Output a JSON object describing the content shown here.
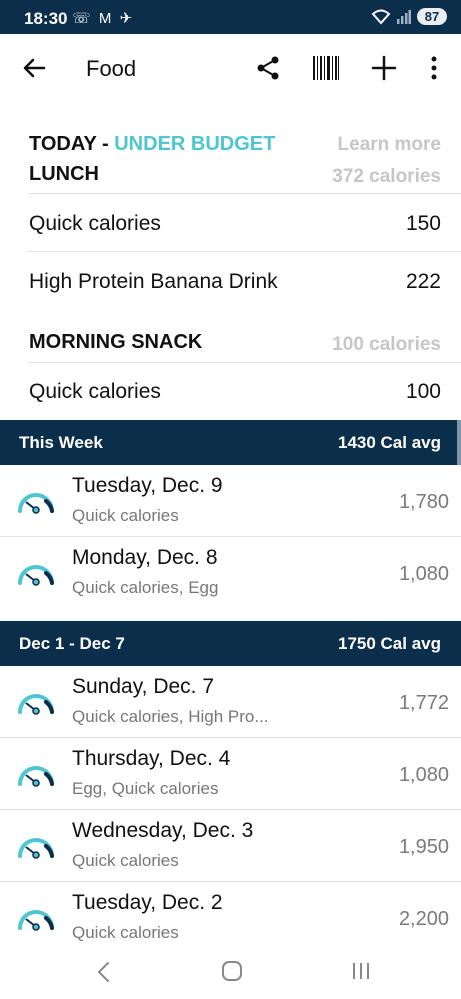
{
  "status": {
    "time": "18:30",
    "icons": "☏ M ✈",
    "battery": "87"
  },
  "appbar": {
    "title": "Food"
  },
  "today": {
    "label": "TODAY",
    "dash": " - ",
    "budget_status": "UNDER BUDGET",
    "learn_more": "Learn more",
    "colors": {
      "accent": "#4ec6d2",
      "navy": "#0b2e4a"
    }
  },
  "lunch": {
    "label": "LUNCH",
    "calories": "372 calories",
    "items": [
      {
        "name": "Quick calories",
        "value": "150"
      },
      {
        "name": "High Protein Banana Drink",
        "value": "222"
      }
    ]
  },
  "morning_snack": {
    "label": "MORNING SNACK",
    "calories": "100 calories",
    "items": [
      {
        "name": "Quick calories",
        "value": "100"
      }
    ]
  },
  "weeks": [
    {
      "label": "This Week",
      "avg": "1430 Cal avg",
      "days": [
        {
          "day": "Tuesday, Dec. 9",
          "foods": "Quick calories",
          "calories": "1,780"
        },
        {
          "day": "Monday, Dec. 8",
          "foods": "Quick calories, Egg",
          "calories": "1,080"
        }
      ]
    },
    {
      "label": "Dec 1 - Dec 7",
      "avg": "1750 Cal avg",
      "days": [
        {
          "day": "Sunday, Dec. 7",
          "foods": "Quick calories, High Pro...",
          "calories": "1,772"
        },
        {
          "day": "Thursday, Dec. 4",
          "foods": "Egg, Quick calories",
          "calories": "1,080"
        },
        {
          "day": "Wednesday, Dec. 3",
          "foods": "Quick calories",
          "calories": "1,950"
        },
        {
          "day": "Tuesday, Dec. 2",
          "foods": "Quick calories",
          "calories": "2,200"
        }
      ]
    }
  ]
}
